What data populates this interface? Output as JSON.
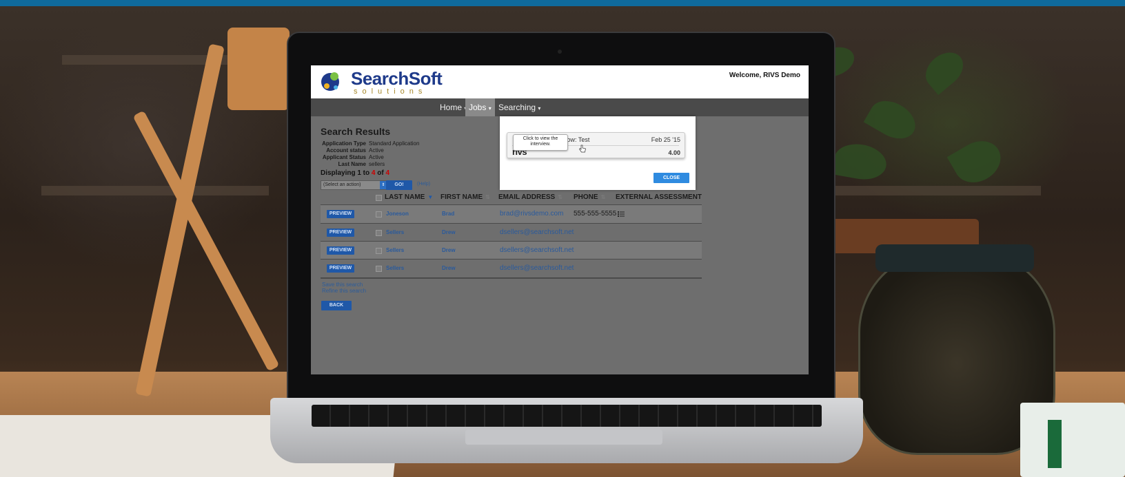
{
  "header": {
    "logo_text": "SearchSoft",
    "logo_sub": "solutions",
    "welcome": "Welcome, RIVS Demo"
  },
  "nav": {
    "items": [
      {
        "label": "Home",
        "caret": "▾"
      },
      {
        "label": "Jobs",
        "caret": "▾"
      },
      {
        "label": "Searching",
        "caret": "▾"
      }
    ],
    "active": "Jobs"
  },
  "search": {
    "title": "Search Results",
    "criteria": [
      {
        "key": "Application Type",
        "value": "Standard Application"
      },
      {
        "key": "Account status",
        "value": "Active"
      },
      {
        "key": "Applicant Status",
        "value": "Active"
      },
      {
        "key": "Last Name",
        "value": "sellers"
      }
    ],
    "displaying_prefix": "Displaying 1 to ",
    "displaying_to": "4",
    "displaying_of": " of ",
    "displaying_total": "4",
    "action_select": "(Select an action)",
    "go_label": "GO!",
    "help_label": "(Help)"
  },
  "table": {
    "headers": {
      "last_name": "LAST NAME",
      "first_name": "FIRST NAME",
      "email": "EMAIL ADDRESS",
      "phone": "PHONE",
      "external": "EXTERNAL ASSESSMENT"
    },
    "preview_label": "PREVIEW",
    "rows": [
      {
        "last_name": "Joneson",
        "first_name": "Brad",
        "email": "brad@rivsdemo.com",
        "phone": "555-555-5555"
      },
      {
        "last_name": "Sellers",
        "first_name": "Drew",
        "email": "dsellers@searchsoft.net",
        "phone": ""
      },
      {
        "last_name": "Sellers",
        "first_name": "Drew",
        "email": "dsellers@searchsoft.net",
        "phone": ""
      },
      {
        "last_name": "Sellers",
        "first_name": "Drew",
        "email": "dsellers@searchsoft.net",
        "phone": ""
      }
    ]
  },
  "links": {
    "save_search": "Save this search",
    "refine_search": "Refine this search",
    "back_label": "BACK"
  },
  "modal": {
    "card_title": "flow: Test",
    "card_date": "Feb 25 '15",
    "card_logo": "rivs",
    "card_score": "4.00",
    "tooltip": "Click to view the interview.",
    "close_label": "CLOSE"
  },
  "colors": {
    "topbar": "#0f6a9c",
    "brand_blue": "#1e3a8a",
    "button_blue": "#1f58a8",
    "close_blue": "#2f8be0",
    "count_red": "#cc0000"
  }
}
